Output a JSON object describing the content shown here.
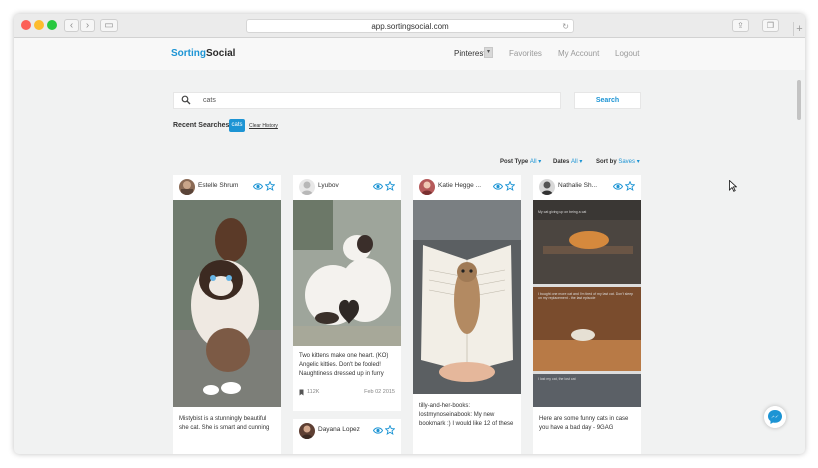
{
  "browser": {
    "url": "app.sortingsocial.com"
  },
  "nav": {
    "logo_part1": "Sorting",
    "logo_part2": "Social",
    "network": "Pinterest",
    "favorites": "Favorites",
    "account": "My Account",
    "logout": "Logout"
  },
  "search": {
    "value": "cats",
    "button": "Search"
  },
  "recent": {
    "label": "Recent Searches:",
    "tag": "cats",
    "clear": "Clear History"
  },
  "filters": {
    "post_type_label": "Post Type",
    "post_type_value": "All",
    "dates_label": "Dates",
    "dates_value": "All",
    "sort_label": "Sort by",
    "sort_value": "Saves"
  },
  "cards": [
    {
      "user": "Estelle Shrum",
      "desc": "Mistybist is a stunningly beautiful she cat. She is smart and cunning"
    },
    {
      "user": "Lyubov",
      "desc": "Two kittens make one heart. (KO) Angelic kitties. Don't be fooled! Naughtiness dressed up in furry",
      "saves": "112K",
      "date": "Feb 02 2015"
    },
    {
      "user": "Katie Hegge ...",
      "desc": "tilly-and-her-books: lostmynoseinabook: My new bookmark :) I would like 12 of these"
    },
    {
      "user": "Nathalie Sh...",
      "desc": "Here are some funny cats in case you have a bad day - 9GAG",
      "img_caption_1": "My cat giving up on being a cat",
      "img_caption_2": "I bought one more cat and I'm tired of my last cat. Don't sleep on my replacement - the last episode",
      "img_caption_3": "I lost my cat, the lost cat"
    },
    {
      "user": "Dayana Lopez"
    }
  ],
  "colors": {
    "accent": "#1c94d4",
    "window_bg": "#f1f2f2"
  }
}
